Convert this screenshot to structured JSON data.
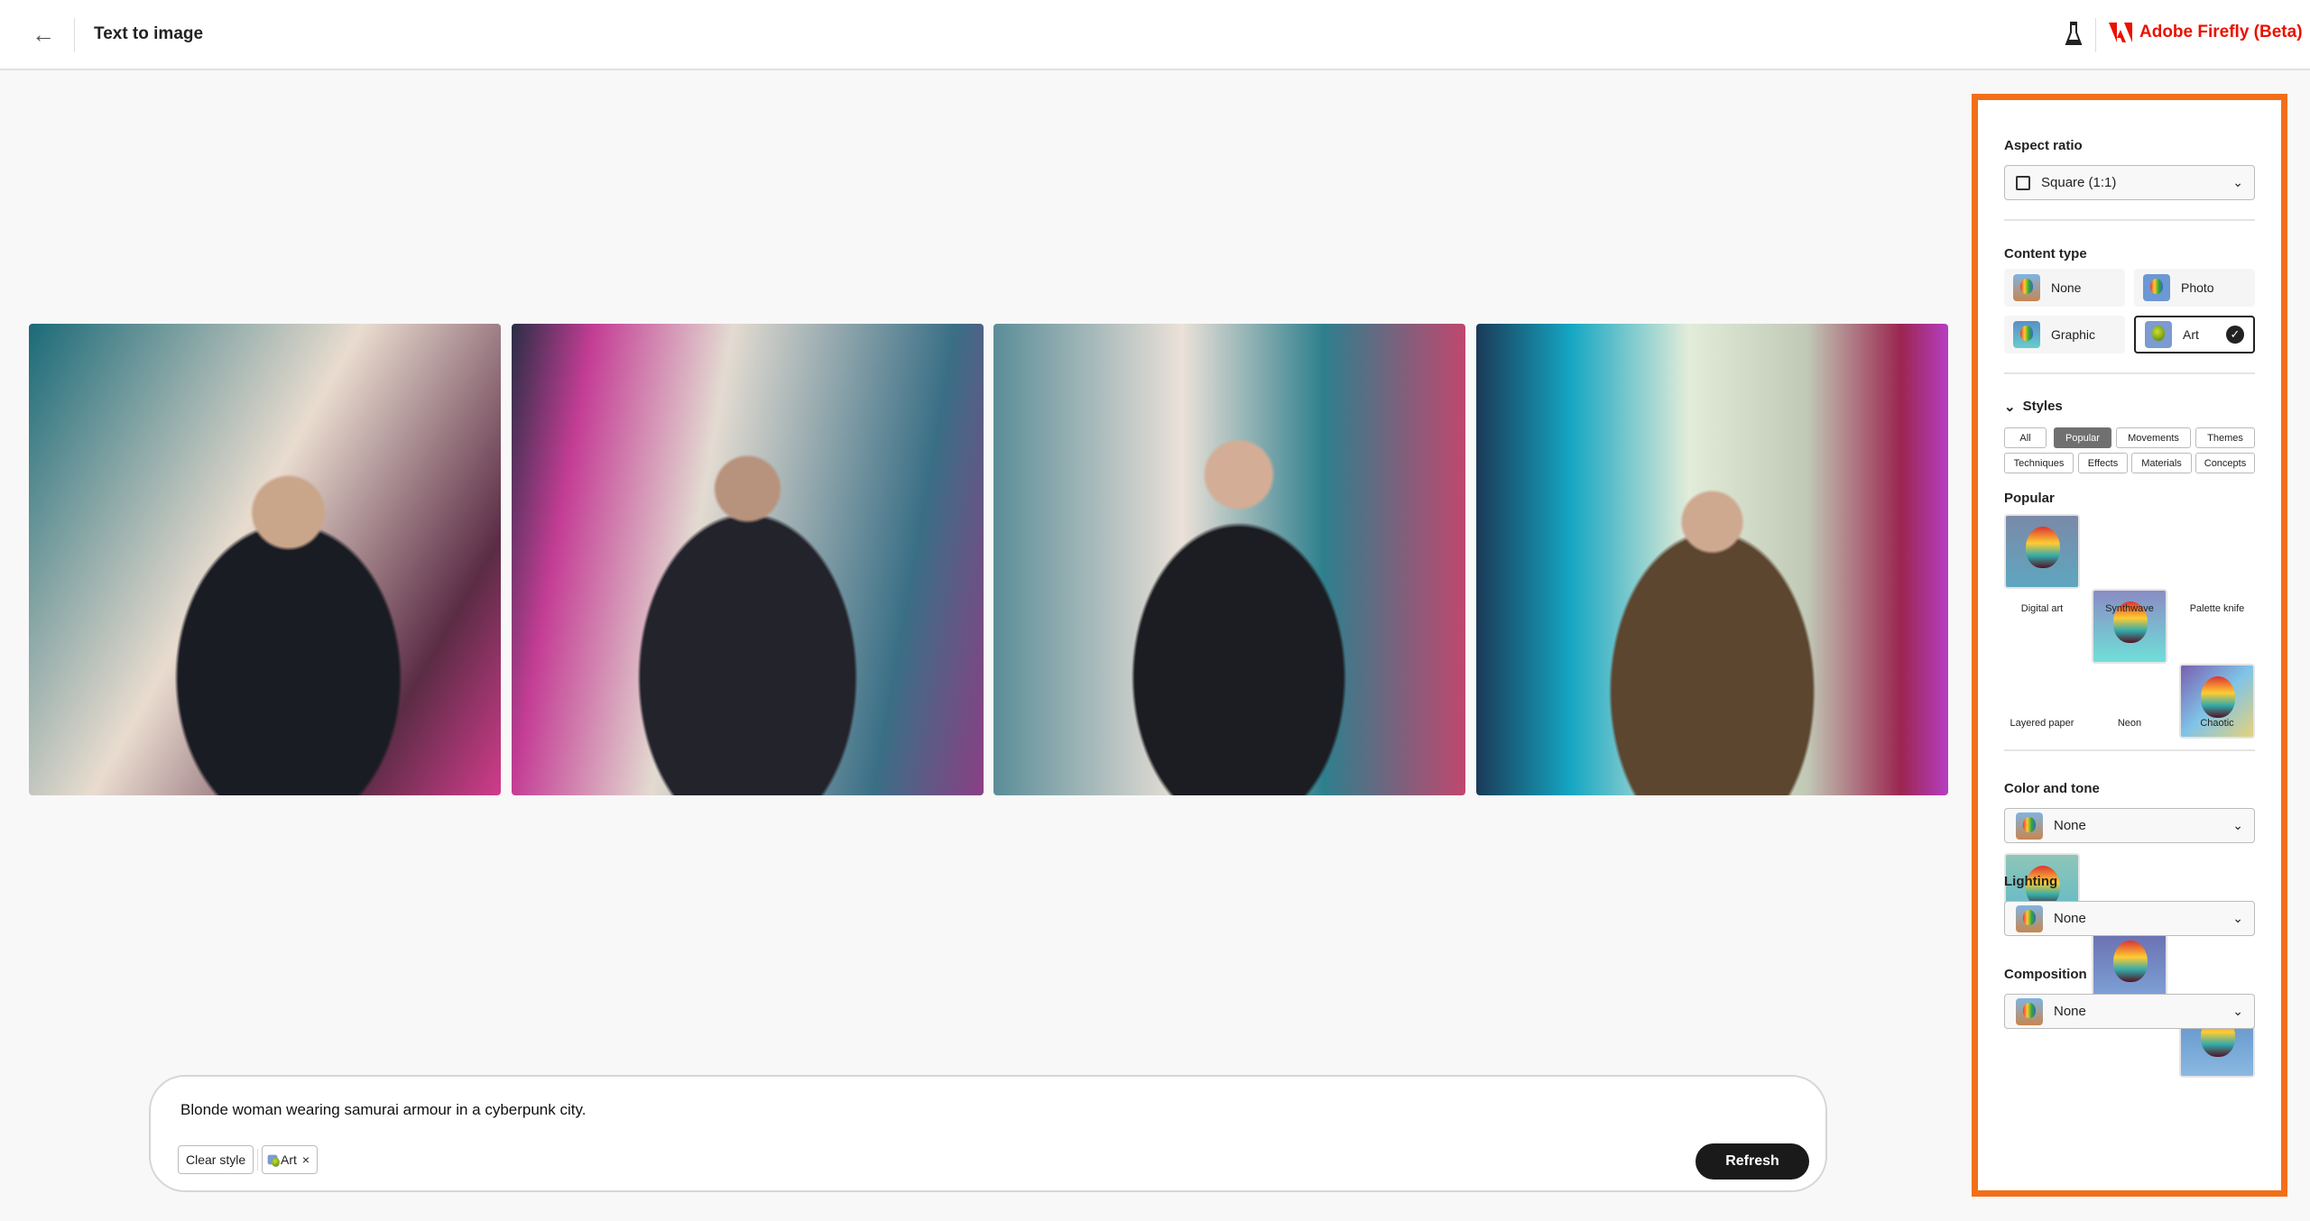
{
  "header": {
    "title": "Text to image",
    "brand": "Adobe Firefly (Beta)",
    "back_icon": "arrow-left-icon",
    "labs_icon": "flask-icon",
    "brand_color": "#eb1000"
  },
  "gallery": {
    "images": [
      "generated image 1",
      "generated image 2",
      "generated image 3",
      "generated image 4"
    ]
  },
  "prompt": {
    "text": "Blonde woman wearing samurai armour in a cyberpunk city.",
    "clear_style": "Clear style",
    "style_chip": "Art",
    "remove_icon": "×",
    "refresh": "Refresh"
  },
  "panel": {
    "highlight_color": "#f26f1a",
    "aspect_ratio": {
      "label": "Aspect ratio",
      "value": "Square (1:1)"
    },
    "content_type": {
      "label": "Content type",
      "options": [
        "None",
        "Photo",
        "Graphic",
        "Art"
      ],
      "selected": "Art"
    },
    "styles": {
      "label": "Styles",
      "filters": [
        "All",
        "Popular",
        "Movements",
        "Themes",
        "Techniques",
        "Effects",
        "Materials",
        "Concepts"
      ],
      "active_filter": "Popular"
    },
    "popular": {
      "label": "Popular",
      "items": [
        "Digital art",
        "Synthwave",
        "Palette knife",
        "Layered paper",
        "Neon",
        "Chaotic"
      ]
    },
    "color_tone": {
      "label": "Color and tone",
      "value": "None"
    },
    "lighting": {
      "label": "Lighting",
      "value": "None"
    },
    "composition": {
      "label": "Composition",
      "value": "None"
    }
  }
}
